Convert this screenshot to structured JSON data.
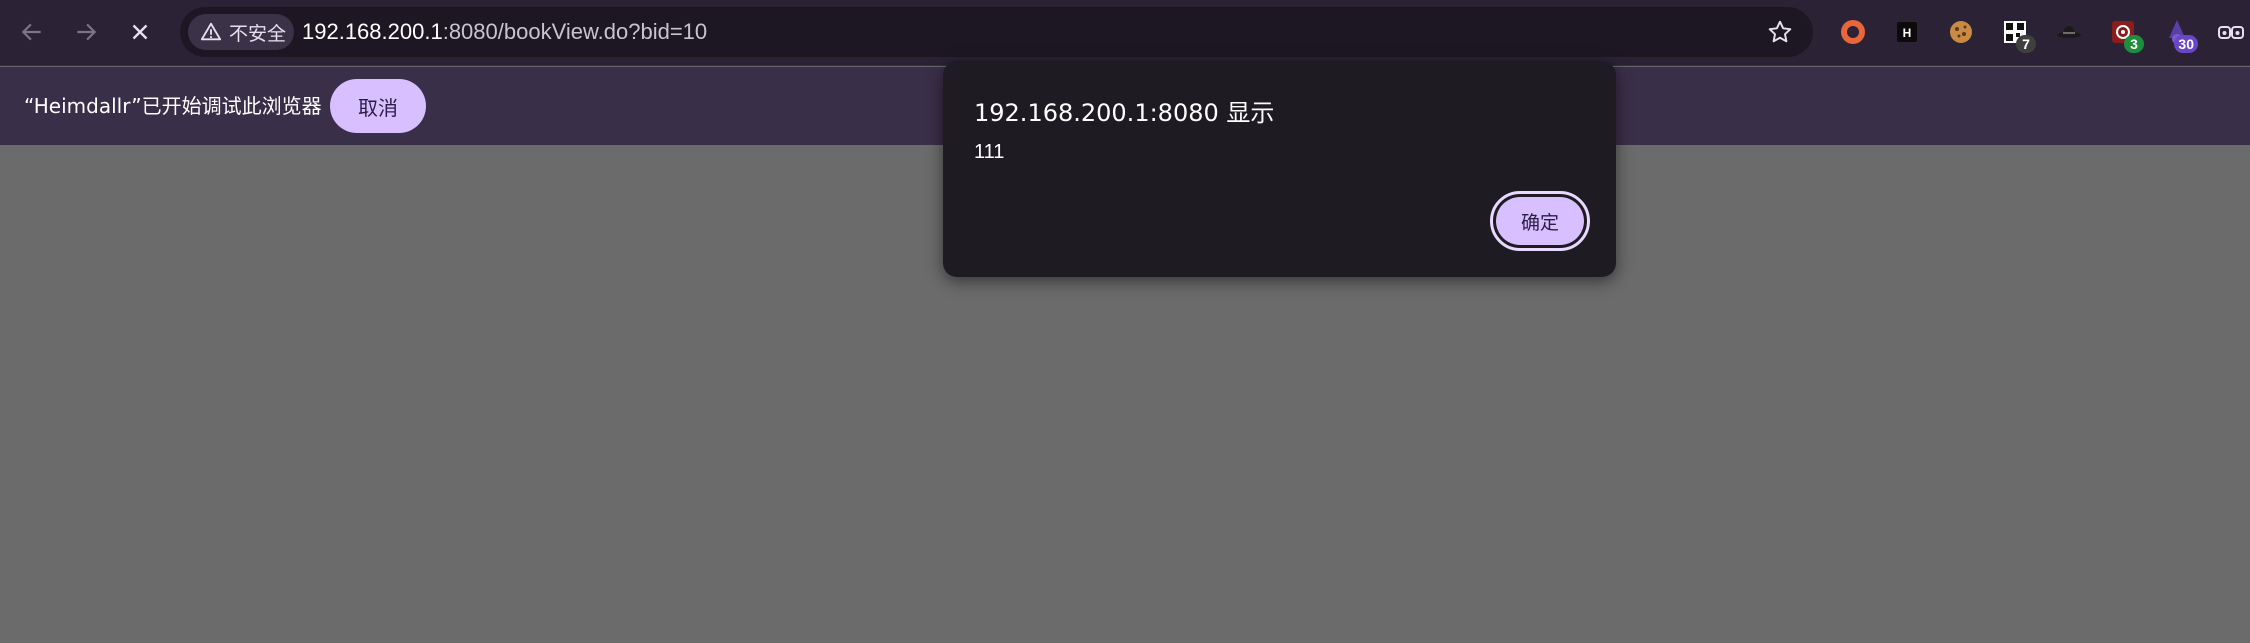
{
  "browser": {
    "security_label": "不安全",
    "url_host": "192.168.200.1",
    "url_rest": ":8080/bookView.do?bid=10"
  },
  "extensions": [
    {
      "name": "record-icon",
      "badge": ""
    },
    {
      "name": "heimdallr-icon",
      "badge": ""
    },
    {
      "name": "cookie-icon",
      "badge": ""
    },
    {
      "name": "qr-extension-icon",
      "badge": "7"
    },
    {
      "name": "spy-hat-icon",
      "badge": ""
    },
    {
      "name": "target-extension-icon",
      "badge": "3"
    },
    {
      "name": "wizard-icon",
      "badge": "30"
    },
    {
      "name": "glasses-icon",
      "badge": ""
    }
  ],
  "infobar": {
    "message": "“Heimdallr”已开始调试此浏览器",
    "cancel_label": "取消"
  },
  "dialog": {
    "title": "192.168.200.1:8080 显示",
    "message": "111",
    "ok_label": "确定"
  },
  "colors": {
    "toolbar": "#2b2236",
    "infobar": "#3a2f48",
    "accent": "#d8bfff",
    "page": "#6b6b6b",
    "dialog": "#1f1b22"
  }
}
